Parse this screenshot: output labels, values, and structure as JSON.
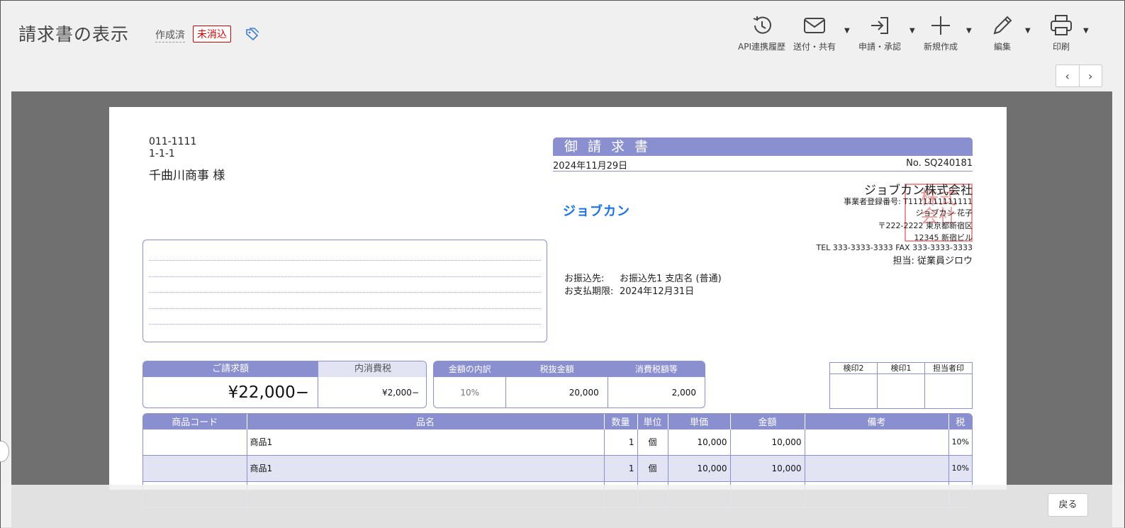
{
  "header": {
    "title": "請求書の表示",
    "status_created": "作成済",
    "status_unpaid": "未消込"
  },
  "toolbar": {
    "api_history": "API連携履歴",
    "send_share": "送付・共有",
    "apply_approve": "申請・承認",
    "new_create": "新規作成",
    "edit": "編集",
    "print": "印刷"
  },
  "nav": {
    "prev": "‹",
    "next": "›"
  },
  "invoice": {
    "postal": "011-1111",
    "address": "1-1-1",
    "recipient": "千曲川商事 様",
    "title": "御請求書",
    "date": "2024年11月29日",
    "number": "No. SQ240181",
    "logo": "ジョブカン",
    "company": "ジョブカン株式会社",
    "reg_no": "事業者登録番号: T1111111111111",
    "rep": "ジョブカン 花子",
    "co_address1": "〒222-2222 東京都新宿区",
    "co_address2": "12345 新宿ビル",
    "tel_fax": "TEL 333-3333-3333 FAX 333-3333-3333",
    "stamp_text": "株式会社",
    "tantou": "担当: 従業員ジロウ",
    "bank_label": "お振込先:",
    "bank_value": "お振込先1 支店名 (普通)",
    "due_label": "お支払期限:",
    "due_value": "2024年12月31日",
    "total_label": "ご請求額",
    "total_value": "¥22,000−",
    "tax_incl_label": "内消費税",
    "tax_incl_value": "¥2,000−",
    "breakdown": {
      "h_rate": "金額の内訳",
      "h_net": "税抜金額",
      "h_tax": "消費税額等",
      "rate": "10%",
      "net": "20,000",
      "tax": "2,000"
    },
    "stamps": [
      "検印2",
      "検印1",
      "担当者印"
    ],
    "items_headers": [
      "商品コード",
      "品名",
      "数量",
      "単位",
      "単価",
      "金額",
      "備考",
      "税"
    ],
    "items": [
      {
        "code": "",
        "name": "商品1",
        "qty": "1",
        "unit": "個",
        "price": "10,000",
        "amount": "10,000",
        "note": "",
        "tax": "10%"
      },
      {
        "code": "",
        "name": "商品1",
        "qty": "1",
        "unit": "個",
        "price": "10,000",
        "amount": "10,000",
        "note": "",
        "tax": "10%"
      }
    ]
  },
  "footer": {
    "back": "戻る"
  }
}
